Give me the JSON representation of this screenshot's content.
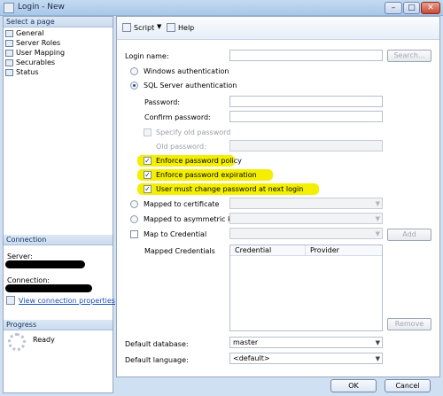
{
  "window": {
    "title": "Login - New"
  },
  "left": {
    "select_page_header": "Select a page",
    "pages": [
      "General",
      "Server Roles",
      "User Mapping",
      "Securables",
      "Status"
    ],
    "connection_header": "Connection",
    "server_label": "Server:",
    "connection_label": "Connection:",
    "view_props_link": "View connection properties",
    "progress_header": "Progress",
    "progress_status": "Ready"
  },
  "toolbar": {
    "script_label": "Script",
    "help_label": "Help"
  },
  "form": {
    "login_name_label": "Login name:",
    "search_button": "Search...",
    "windows_auth": "Windows authentication",
    "sql_auth": "SQL Server authentication",
    "password_label": "Password:",
    "confirm_password_label": "Confirm password:",
    "specify_old_password": "Specify old password",
    "old_password_label": "Old password:",
    "enforce_policy": "Enforce password policy",
    "enforce_expiration": "Enforce password expiration",
    "must_change": "User must change password at next login",
    "mapped_certificate": "Mapped to certificate",
    "mapped_asym_key": "Mapped to asymmetric key",
    "map_credential": "Map to Credential",
    "add_button": "Add",
    "mapped_credentials_label": "Mapped Credentials",
    "grid_col_credential": "Credential",
    "grid_col_provider": "Provider",
    "remove_button": "Remove",
    "default_database_label": "Default database:",
    "default_database_value": "master",
    "default_language_label": "Default language:",
    "default_language_value": "<default>"
  },
  "buttons": {
    "ok": "OK",
    "cancel": "Cancel"
  },
  "colors": {
    "highlight": "#f4ef00",
    "link": "#1a4fb8"
  }
}
